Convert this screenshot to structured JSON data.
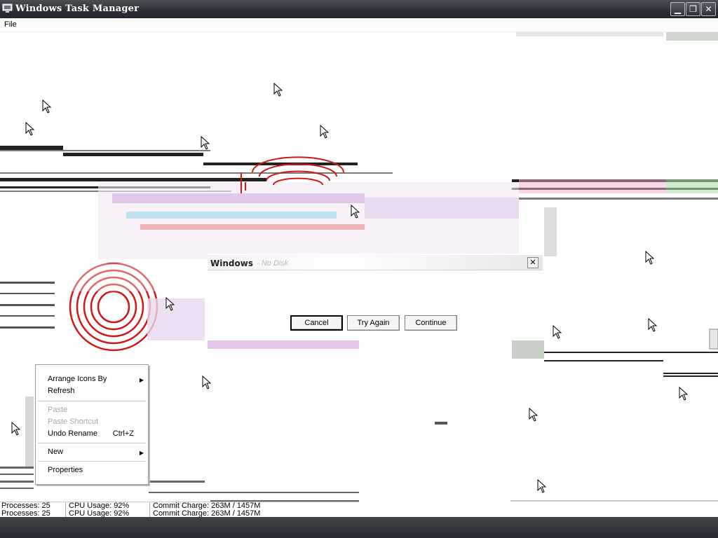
{
  "window": {
    "title": "Windows Task Manager",
    "minimize_glyph": "▁",
    "restore_glyph": "❐",
    "close_glyph": "✕"
  },
  "menu": {
    "file": "File"
  },
  "dialog": {
    "title": "Windows",
    "subtitle": "- No Disk",
    "close_glyph": "✕",
    "buttons": {
      "cancel": "Cancel",
      "try_again": "Try Again",
      "continue": "Continue"
    }
  },
  "context_menu": {
    "items": [
      {
        "label": "Arrange Icons By",
        "submenu": true,
        "disabled": false
      },
      {
        "label": "Refresh",
        "submenu": false,
        "disabled": false
      },
      {
        "label": "Paste",
        "submenu": false,
        "disabled": true
      },
      {
        "label": "Paste Shortcut",
        "submenu": false,
        "disabled": true
      },
      {
        "label": "Undo Rename",
        "shortcut": "Ctrl+Z",
        "submenu": false,
        "disabled": false
      },
      {
        "label": "New",
        "submenu": true,
        "disabled": false
      },
      {
        "label": "Properties",
        "submenu": false,
        "disabled": false
      }
    ],
    "submenu_arrow": "▶"
  },
  "status_bar": {
    "processes": "Processes: 25",
    "cpu_usage": "CPU Usage: 92%",
    "commit_charge": "Commit Charge: 263M / 1457M"
  },
  "colors": {
    "titlebar": "#2b2f35",
    "glitch_red": "#d01818",
    "glitch_magenta": "#c040c0",
    "glitch_cyan": "#40c8e0"
  },
  "icons": {
    "app": "computer-icon",
    "cursor": "arrow-cursor-icon"
  }
}
